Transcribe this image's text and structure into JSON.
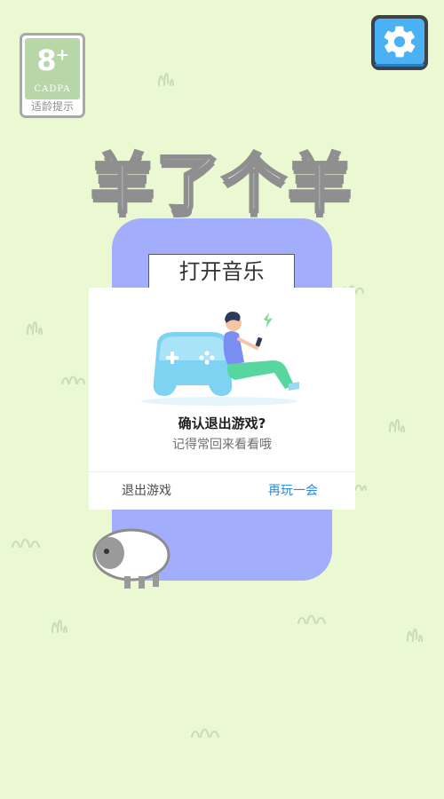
{
  "age_rating": {
    "age": "8",
    "plus": "+",
    "org": "CADPA",
    "tip": "适龄提示"
  },
  "settings": {
    "icon": "gear-icon"
  },
  "game_title": "羊了个羊",
  "music_button": "打开音乐",
  "dialog": {
    "illustration": "gamepad-person-illustration",
    "title": "确认退出游戏?",
    "subtitle": "记得常回来看看哦",
    "exit_label": "退出游戏",
    "stay_label": "再玩一会"
  },
  "colors": {
    "background": "#eaf9d2",
    "panel": "#a2adfb",
    "settings_button": "#4ab2f4",
    "stay_button_text": "#2b8ae4"
  }
}
